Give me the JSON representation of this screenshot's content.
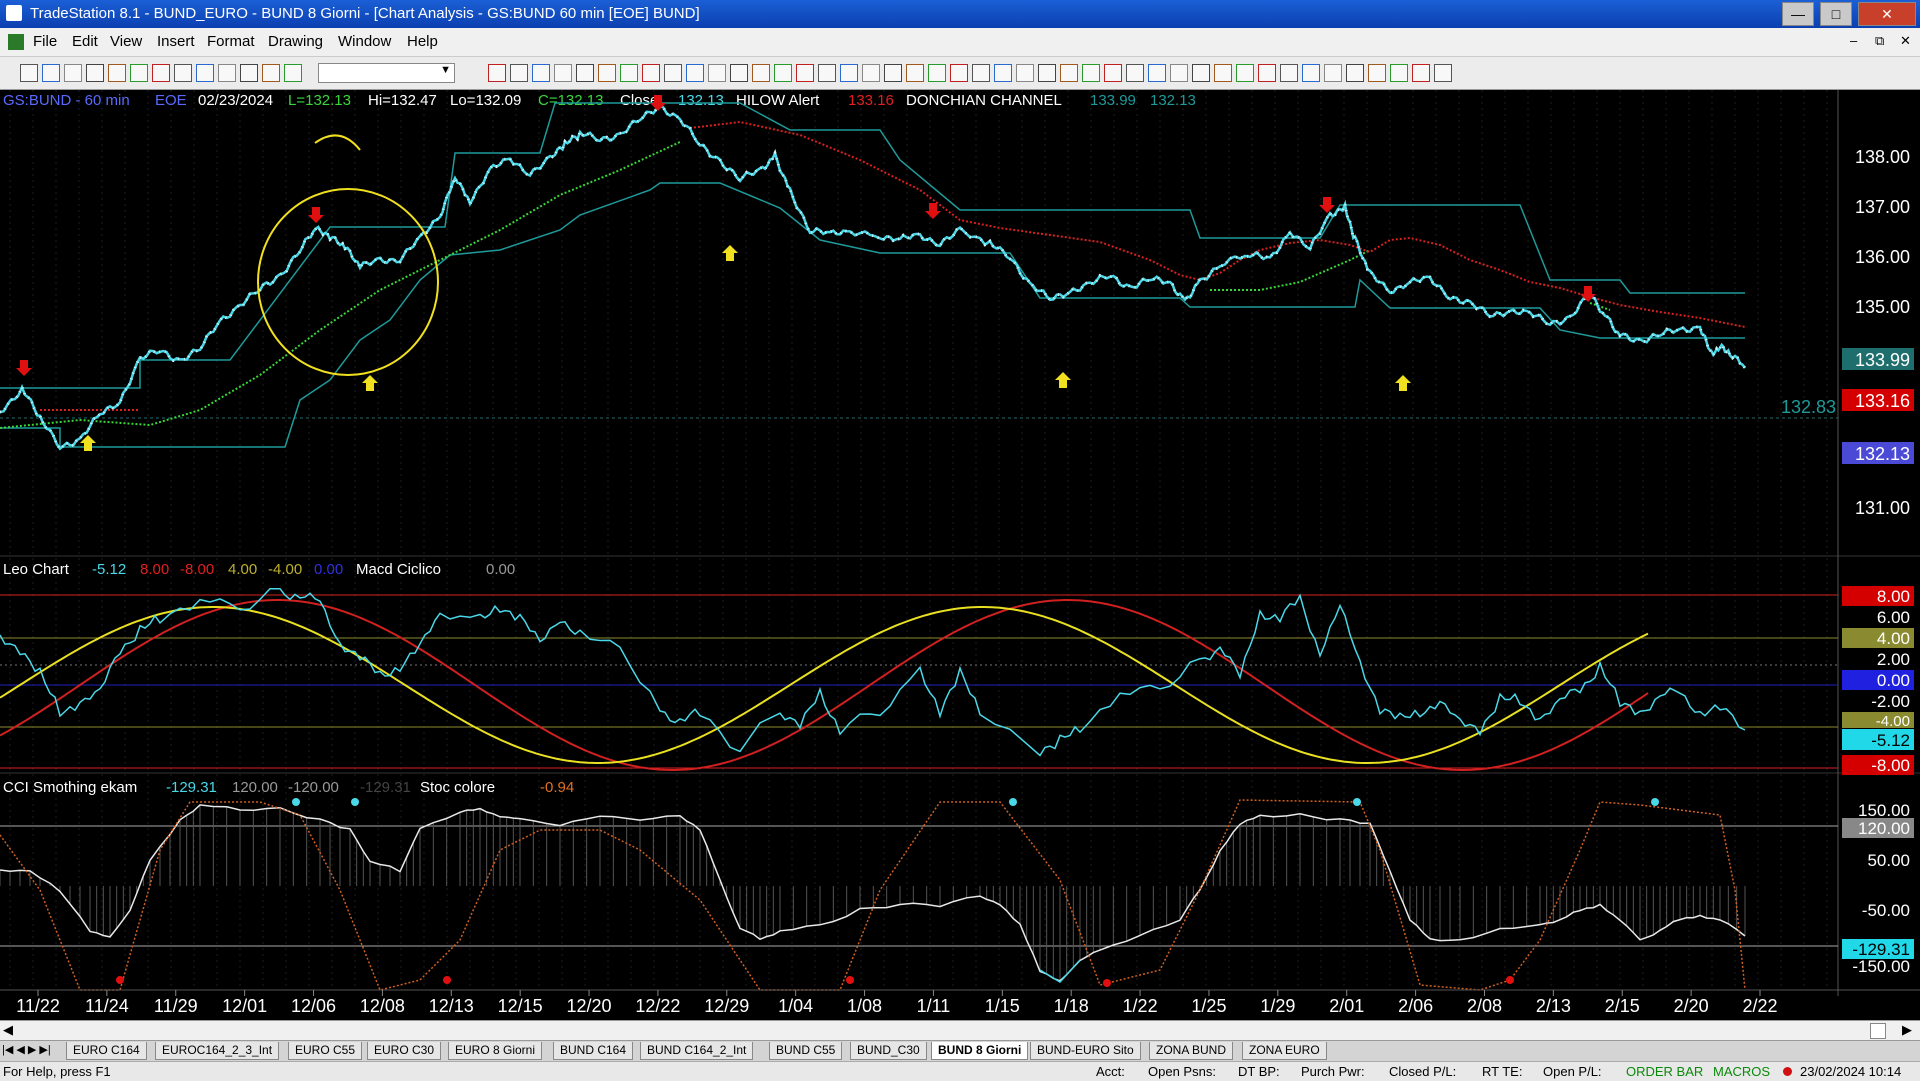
{
  "window": {
    "title": "TradeStation 8.1 - BUND_EURO - BUND 8 Giorni - [Chart Analysis - GS:BUND  60 min  [EOE] BUND]"
  },
  "menu": [
    "File",
    "Edit",
    "View",
    "Insert",
    "Format",
    "Drawing",
    "Window",
    "Help"
  ],
  "chart": {
    "header": {
      "symbol": "GS:BUND - 60 min",
      "exchange": "EOE",
      "date": "02/23/2024",
      "last": "L=132.13",
      "hi": "Hi=132.47",
      "lo": "Lo=132.09",
      "close": "C=132.13",
      "close_label": "Close",
      "close_value": "132.13",
      "hilow_label": "HILOW Alert",
      "hilow_value": "133.16",
      "donchian_label": "DONCHIAN CHANNEL",
      "donchian_upper": "133.99",
      "donchian_lower": "132.13"
    },
    "price_axis": [
      "138.00",
      "137.00",
      "136.00",
      "135.00",
      "131.00"
    ],
    "price_badges": [
      {
        "text": "133.99",
        "bg": "#1f6e6e"
      },
      {
        "text": "133.16",
        "bg": "#d40000"
      },
      {
        "text": "132.13",
        "bg": "#4a4ad6"
      }
    ],
    "crosshair_value": "132.83",
    "osc1": {
      "name": "Leo Chart",
      "v1": "-5.12",
      "v2": "8.00",
      "v3": "-8.00",
      "v4": "4.00",
      "v5": "-4.00",
      "v6": "0.00",
      "name2": "Macd Ciclico",
      "v7": "0.00",
      "axis": [
        "8.00",
        "6.00",
        "4.00",
        "2.00",
        "0.00",
        "-2.00",
        "-4.00",
        "-5.12",
        "-8.00"
      ]
    },
    "osc2": {
      "name": "CCI Smothing ekam",
      "v1": "-129.31",
      "v2": "120.00",
      "v3": "-120.00",
      "v4": "-129.31",
      "name2": "Stoc colore",
      "v5": "-0.94",
      "axis": [
        "150.00",
        "120.00",
        "50.00",
        "-50.00",
        "-129.31",
        "-150.00"
      ]
    },
    "date_axis": [
      "11/22",
      "11/24",
      "11/29",
      "12/01",
      "12/06",
      "12/08",
      "12/13",
      "12/15",
      "12/20",
      "12/22",
      "12/29",
      "1/04",
      "1/08",
      "1/11",
      "1/15",
      "1/18",
      "1/22",
      "1/25",
      "1/29",
      "2/01",
      "2/06",
      "2/08",
      "2/13",
      "2/15",
      "2/20",
      "2/22"
    ]
  },
  "tabs": [
    "EURO C164",
    "EUROC164_2_3_Int",
    "EURO C55",
    "EURO C30",
    "EURO 8 Giorni",
    "BUND C164",
    "BUND C164_2_Int",
    "BUND C55",
    "BUND_C30",
    "BUND 8 Giorni",
    "BUND-EURO Sito",
    "ZONA BUND",
    "ZONA EURO"
  ],
  "active_tab": "BUND 8 Giorni",
  "status": {
    "help": "For Help, press F1",
    "acct": "Acct:",
    "open_psns": "Open Psns:",
    "dtbp": "DT BP:",
    "purch_pwr": "Purch Pwr:",
    "closed_pl": "Closed P/L:",
    "rt_te": "RT TE:",
    "open_pl": "Open P/L:",
    "order_bar": "ORDER BAR",
    "macros": "MACROS",
    "datetime": "23/02/2024 10:14"
  }
}
